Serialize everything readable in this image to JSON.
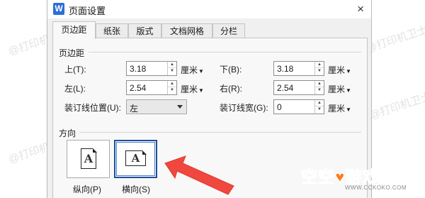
{
  "dialog": {
    "title": "页面设置",
    "app_icon": "W",
    "close_symbol": "×"
  },
  "tabs": [
    {
      "label": "页边距",
      "active": true
    },
    {
      "label": "纸张",
      "active": false
    },
    {
      "label": "版式",
      "active": false
    },
    {
      "label": "文档网格",
      "active": false
    },
    {
      "label": "分栏",
      "active": false
    }
  ],
  "margins": {
    "group_title": "页边距",
    "top_label": "上(T):",
    "top_value": "3.18",
    "bottom_label": "下(B):",
    "bottom_value": "3.18",
    "left_label": "左(L):",
    "left_value": "2.54",
    "right_label": "右(R):",
    "right_value": "2.54",
    "gutter_pos_label": "装订线位置(U):",
    "gutter_pos_value": "左",
    "gutter_width_label": "装订线宽(G):",
    "gutter_width_value": "0",
    "unit": "厘米"
  },
  "orientation": {
    "group_title": "方向",
    "portrait_label": "纵向(P)",
    "landscape_label": "横向(S)",
    "page_letter": "A",
    "selected": "landscape"
  },
  "annotation": {
    "arrow_color": "#f0483e",
    "arrow_icon": "red-arrow-icon"
  },
  "watermark": {
    "text": "@打印机卫士"
  },
  "brand": {
    "name_part1": "空空",
    "name_part2": "游戏园",
    "url": "WWW.CCKOKO.COM"
  },
  "colors": {
    "accent": "#1f4f9a",
    "brand_blue": "#1865d6",
    "brand_orange": "#ff7a1a",
    "dialog_bg": "#f0f0f0"
  }
}
